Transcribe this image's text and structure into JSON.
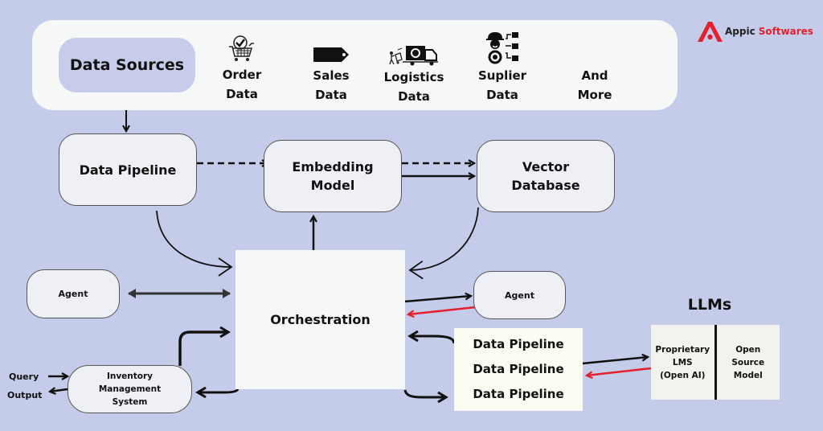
{
  "brand": {
    "name_part1": "Appic",
    "name_part2": "Softwares",
    "logo_icon": "appic-a-logo-icon",
    "accent_color": "#e3202e"
  },
  "data_sources": {
    "title": "Data Sources",
    "items": [
      {
        "icon": "shopping-cart-check-icon",
        "line1": "Order",
        "line2": "Data"
      },
      {
        "icon": "price-tag-icon",
        "line1": "Sales",
        "line2": "Data"
      },
      {
        "icon": "delivery-truck-icon",
        "line1": "Logistics",
        "line2": "Data"
      },
      {
        "icon": "supplier-worker-icon",
        "line1": "Suplier",
        "line2": "Data"
      },
      {
        "icon": "",
        "line1": "And",
        "line2": "More"
      }
    ]
  },
  "nodes": {
    "data_pipeline": "Data Pipeline",
    "embedding_model": {
      "line1": "Embedding",
      "line2": "Model"
    },
    "vector_database": {
      "line1": "Vector",
      "line2": "Database"
    },
    "agent_left": "Agent",
    "agent_right": "Agent",
    "orchestration": "Orchestration",
    "inventory": {
      "line1": "Inventory",
      "line2": "Management",
      "line3": "System"
    },
    "query_label": "Query",
    "output_label": "Output",
    "pipelines": [
      "Data Pipeline",
      "Data Pipeline",
      "Data Pipeline"
    ]
  },
  "llms": {
    "title": "LLMs",
    "proprietary": {
      "line1": "Proprietary",
      "line2": "LMS",
      "line3": "(Open AI)"
    },
    "open_source": {
      "line1": "Open",
      "line2": "Source",
      "line3": "Model"
    }
  },
  "colors": {
    "background": "#c5cce9",
    "panel": "#f6f8f8",
    "node": "#eff0f5",
    "return_arrow": "#e3202e"
  }
}
